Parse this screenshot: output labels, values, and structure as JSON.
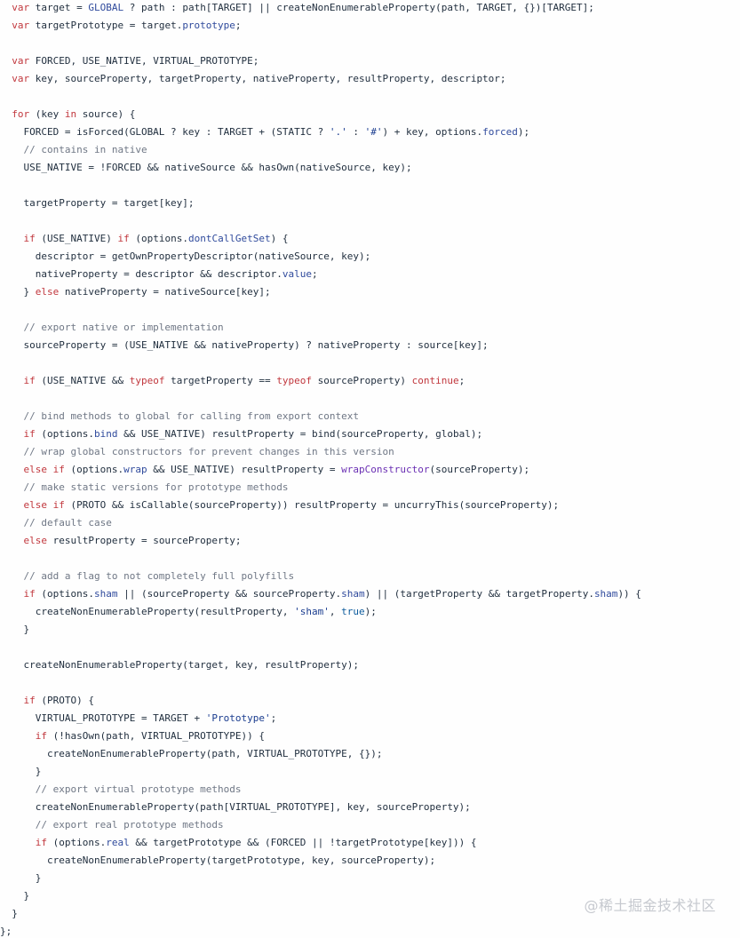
{
  "code": {
    "lines": [
      [
        [
          "kw",
          "  var"
        ],
        [
          "id",
          " target = "
        ],
        [
          "prop",
          "GLOBAL"
        ],
        [
          "id",
          " ? path : path[TARGET] || createNonEnumerableProperty(path, TARGET, {})[TARGET];"
        ]
      ],
      [
        [
          "kw",
          "  var"
        ],
        [
          "id",
          " targetPrototype = target."
        ],
        [
          "prop",
          "prototype"
        ],
        [
          "id",
          ";"
        ]
      ],
      [
        [
          "id",
          ""
        ]
      ],
      [
        [
          "kw",
          "  var"
        ],
        [
          "id",
          " FORCED, USE_NATIVE, VIRTUAL_PROTOTYPE;"
        ]
      ],
      [
        [
          "kw",
          "  var"
        ],
        [
          "id",
          " key, sourceProperty, targetProperty, nativeProperty, resultProperty, descriptor;"
        ]
      ],
      [
        [
          "id",
          ""
        ]
      ],
      [
        [
          "kw",
          "  for"
        ],
        [
          "id",
          " (key "
        ],
        [
          "kw",
          "in"
        ],
        [
          "id",
          " source) {"
        ]
      ],
      [
        [
          "id",
          "    FORCED = isForced(GLOBAL ? key : TARGET + (STATIC ? "
        ],
        [
          "str",
          "'.'"
        ],
        [
          "id",
          " : "
        ],
        [
          "str",
          "'#'"
        ],
        [
          "id",
          ") + key, options."
        ],
        [
          "prop",
          "forced"
        ],
        [
          "id",
          ");"
        ]
      ],
      [
        [
          "comment",
          "    // contains in native"
        ]
      ],
      [
        [
          "id",
          "    USE_NATIVE = !FORCED && nativeSource && hasOwn(nativeSource, key);"
        ]
      ],
      [
        [
          "id",
          ""
        ]
      ],
      [
        [
          "id",
          "    targetProperty = target[key];"
        ]
      ],
      [
        [
          "id",
          ""
        ]
      ],
      [
        [
          "kw",
          "    if"
        ],
        [
          "id",
          " (USE_NATIVE) "
        ],
        [
          "kw",
          "if"
        ],
        [
          "id",
          " (options."
        ],
        [
          "prop",
          "dontCallGetSet"
        ],
        [
          "id",
          ") {"
        ]
      ],
      [
        [
          "id",
          "      descriptor = getOwnPropertyDescriptor(nativeSource, key);"
        ]
      ],
      [
        [
          "id",
          "      nativeProperty = descriptor && descriptor."
        ],
        [
          "prop",
          "value"
        ],
        [
          "id",
          ";"
        ]
      ],
      [
        [
          "id",
          "    } "
        ],
        [
          "kw",
          "else"
        ],
        [
          "id",
          " nativeProperty = nativeSource[key];"
        ]
      ],
      [
        [
          "id",
          ""
        ]
      ],
      [
        [
          "comment",
          "    // export native or implementation"
        ]
      ],
      [
        [
          "id",
          "    sourceProperty = (USE_NATIVE && nativeProperty) ? nativeProperty : source[key];"
        ]
      ],
      [
        [
          "id",
          ""
        ]
      ],
      [
        [
          "kw",
          "    if"
        ],
        [
          "id",
          " (USE_NATIVE && "
        ],
        [
          "kw",
          "typeof"
        ],
        [
          "id",
          " targetProperty == "
        ],
        [
          "kw",
          "typeof"
        ],
        [
          "id",
          " sourceProperty) "
        ],
        [
          "kw",
          "continue"
        ],
        [
          "id",
          ";"
        ]
      ],
      [
        [
          "id",
          ""
        ]
      ],
      [
        [
          "comment",
          "    // bind methods to global for calling from export context"
        ]
      ],
      [
        [
          "kw",
          "    if"
        ],
        [
          "id",
          " (options."
        ],
        [
          "prop",
          "bind"
        ],
        [
          "id",
          " && USE_NATIVE) resultProperty = bind(sourceProperty, global);"
        ]
      ],
      [
        [
          "comment",
          "    // wrap global constructors for prevent changes in this version"
        ]
      ],
      [
        [
          "kw",
          "    else if"
        ],
        [
          "id",
          " (options."
        ],
        [
          "prop",
          "wrap"
        ],
        [
          "id",
          " && USE_NATIVE) resultProperty = "
        ],
        [
          "fn",
          "wrapConstructor"
        ],
        [
          "id",
          "(sourceProperty);"
        ]
      ],
      [
        [
          "comment",
          "    // make static versions for prototype methods"
        ]
      ],
      [
        [
          "kw",
          "    else if"
        ],
        [
          "id",
          " (PROTO && isCallable(sourceProperty)) resultProperty = uncurryThis(sourceProperty);"
        ]
      ],
      [
        [
          "comment",
          "    // default case"
        ]
      ],
      [
        [
          "kw",
          "    else"
        ],
        [
          "id",
          " resultProperty = sourceProperty;"
        ]
      ],
      [
        [
          "id",
          ""
        ]
      ],
      [
        [
          "comment",
          "    // add a flag to not completely full polyfills"
        ]
      ],
      [
        [
          "kw",
          "    if"
        ],
        [
          "id",
          " (options."
        ],
        [
          "prop",
          "sham"
        ],
        [
          "id",
          " || (sourceProperty && sourceProperty."
        ],
        [
          "prop",
          "sham"
        ],
        [
          "id",
          ") || (targetProperty && targetProperty."
        ],
        [
          "prop",
          "sham"
        ],
        [
          "id",
          ")) {"
        ]
      ],
      [
        [
          "id",
          "      createNonEnumerableProperty(resultProperty, "
        ],
        [
          "str",
          "'sham'"
        ],
        [
          "id",
          ", "
        ],
        [
          "bool",
          "true"
        ],
        [
          "id",
          ");"
        ]
      ],
      [
        [
          "id",
          "    }"
        ]
      ],
      [
        [
          "id",
          ""
        ]
      ],
      [
        [
          "id",
          "    createNonEnumerableProperty(target, key, resultProperty);"
        ]
      ],
      [
        [
          "id",
          ""
        ]
      ],
      [
        [
          "kw",
          "    if"
        ],
        [
          "id",
          " (PROTO) {"
        ]
      ],
      [
        [
          "id",
          "      VIRTUAL_PROTOTYPE = TARGET + "
        ],
        [
          "str",
          "'Prototype'"
        ],
        [
          "id",
          ";"
        ]
      ],
      [
        [
          "kw",
          "      if"
        ],
        [
          "id",
          " (!hasOwn(path, VIRTUAL_PROTOTYPE)) {"
        ]
      ],
      [
        [
          "id",
          "        createNonEnumerableProperty(path, VIRTUAL_PROTOTYPE, {});"
        ]
      ],
      [
        [
          "id",
          "      }"
        ]
      ],
      [
        [
          "comment",
          "      // export virtual prototype methods"
        ]
      ],
      [
        [
          "id",
          "      createNonEnumerableProperty(path[VIRTUAL_PROTOTYPE], key, sourceProperty);"
        ]
      ],
      [
        [
          "comment",
          "      // export real prototype methods"
        ]
      ],
      [
        [
          "kw",
          "      if"
        ],
        [
          "id",
          " (options."
        ],
        [
          "prop",
          "real"
        ],
        [
          "id",
          " && targetPrototype && (FORCED || !targetPrototype[key])) {"
        ]
      ],
      [
        [
          "id",
          "        createNonEnumerableProperty(targetPrototype, key, sourceProperty);"
        ]
      ],
      [
        [
          "id",
          "      }"
        ]
      ],
      [
        [
          "id",
          "    }"
        ]
      ],
      [
        [
          "id",
          "  }"
        ]
      ],
      [
        [
          "id",
          "};"
        ]
      ]
    ]
  },
  "watermark": {
    "text": "@稀土掘金技术社区"
  }
}
